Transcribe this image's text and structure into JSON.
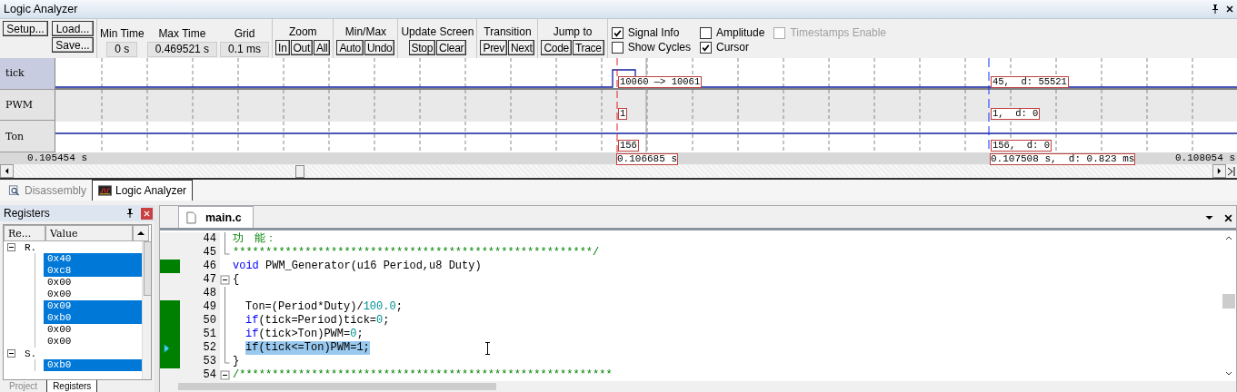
{
  "window": {
    "title": "Logic Analyzer"
  },
  "toolbar": {
    "left_buttons": [
      "Setup...",
      "Load...",
      "Save..."
    ],
    "fields": [
      {
        "label": "Min Time",
        "value": "0 s"
      },
      {
        "label": "Max Time",
        "value": "0.469521 s"
      },
      {
        "label": "Grid",
        "value": "0.1 ms"
      }
    ],
    "button_groups": [
      {
        "title": "Zoom",
        "buttons": [
          "In",
          "Out",
          "All"
        ]
      },
      {
        "title": "Min/Max",
        "buttons": [
          "Auto",
          "Undo"
        ]
      },
      {
        "title": "Update Screen",
        "buttons": [
          "Stop",
          "Clear"
        ]
      },
      {
        "title": "Transition",
        "buttons": [
          "Prev",
          "Next"
        ]
      },
      {
        "title": "Jump to",
        "buttons": [
          "Code",
          "Trace"
        ]
      }
    ],
    "options": [
      {
        "label": "Signal Info",
        "checked": true,
        "disabled": false
      },
      {
        "label": "Amplitude",
        "checked": false,
        "disabled": false
      },
      {
        "label": "Timestamps Enable",
        "checked": false,
        "disabled": true
      },
      {
        "label": "Show Cycles",
        "checked": false,
        "disabled": false
      },
      {
        "label": "Cursor",
        "checked": true,
        "disabled": false
      }
    ]
  },
  "waveform": {
    "signals": [
      {
        "name": "tick",
        "kind": "pulse",
        "cursor_label": "10060 —> 10061",
        "marker_label": "45,  d: 55521"
      },
      {
        "name": "PWM",
        "kind": "empty",
        "cursor_label": "1",
        "marker_label": "1,  d: 0"
      },
      {
        "name": "Ton",
        "kind": "flat",
        "cursor_label": "156",
        "marker_label": "156,  d: 0"
      }
    ],
    "time_axis": {
      "start": "0.105454 s",
      "cursor": "0.106685 s",
      "marker": "0.107508 s,  d: 0.823 ms",
      "end": "0.108054 s"
    }
  },
  "tabs": [
    {
      "label": "Disassembly",
      "selected": false
    },
    {
      "label": "Logic Analyzer",
      "selected": true
    }
  ],
  "registers": {
    "title": "Registers",
    "columns": [
      "Re...",
      "Value"
    ],
    "tree": [
      {
        "label": "R.",
        "expanded": true,
        "children": [
          {
            "value": "0x40",
            "selected": true
          },
          {
            "value": "0xc8",
            "selected": true
          },
          {
            "value": "0x00",
            "selected": false
          },
          {
            "value": "0x00",
            "selected": false
          },
          {
            "value": "0x09",
            "selected": true
          },
          {
            "value": "0xb0",
            "selected": true
          },
          {
            "value": "0x00",
            "selected": false
          },
          {
            "value": "0x00",
            "selected": false
          }
        ]
      },
      {
        "label": "S.",
        "expanded": true,
        "children": [
          {
            "value": "0xb0",
            "selected": true
          }
        ]
      }
    ],
    "tabs": [
      {
        "label": "Project",
        "selected": false
      },
      {
        "label": "Registers",
        "selected": true
      }
    ]
  },
  "editor": {
    "tab": "main.c",
    "lines": [
      {
        "number": "44",
        "executed": false,
        "current": false,
        "selected": false,
        "kind": "fold-body",
        "indented": false,
        "tokens": [
          {
            "text": "功　能：",
            "kind": "comment"
          }
        ]
      },
      {
        "number": "45",
        "executed": false,
        "current": false,
        "selected": false,
        "kind": "fold-end",
        "indented": false,
        "tokens": [
          {
            "text": "*******************************************************/",
            "kind": "comment"
          }
        ]
      },
      {
        "number": "46",
        "executed": true,
        "current": false,
        "selected": false,
        "kind": "plain",
        "indented": false,
        "tokens": [
          {
            "text": "void",
            "kind": "keyword"
          },
          {
            "text": " PWM_Generator(u16 Period,u8 Duty)",
            "kind": "plain"
          }
        ]
      },
      {
        "number": "47",
        "executed": false,
        "current": false,
        "selected": false,
        "kind": "fold-start",
        "indented": false,
        "tokens": [
          {
            "text": "{",
            "kind": "plain"
          }
        ]
      },
      {
        "number": "48",
        "executed": false,
        "current": false,
        "selected": false,
        "kind": "fold-body",
        "indented": false
      },
      {
        "number": "49",
        "executed": true,
        "current": false,
        "selected": false,
        "kind": "fold-body",
        "indented": true,
        "tokens": [
          {
            "text": "Ton=(Period*Duty)/",
            "kind": "plain"
          },
          {
            "text": "100.0",
            "kind": "number"
          },
          {
            "text": ";",
            "kind": "plain"
          }
        ]
      },
      {
        "number": "50",
        "executed": true,
        "current": false,
        "selected": false,
        "kind": "fold-body",
        "indented": true,
        "tokens": [
          {
            "text": "if",
            "kind": "keyword"
          },
          {
            "text": "(tick=Period)tick=",
            "kind": "plain"
          },
          {
            "text": "0",
            "kind": "number"
          },
          {
            "text": ";",
            "kind": "plain"
          }
        ]
      },
      {
        "number": "51",
        "executed": true,
        "current": false,
        "selected": false,
        "kind": "fold-body",
        "indented": true,
        "tokens": [
          {
            "text": "if",
            "kind": "keyword"
          },
          {
            "text": "(tick>Ton)PWM=",
            "kind": "plain"
          },
          {
            "text": "0",
            "kind": "number"
          },
          {
            "text": ";",
            "kind": "plain"
          }
        ]
      },
      {
        "number": "52",
        "executed": true,
        "current": true,
        "selected": true,
        "kind": "fold-body",
        "indented": true,
        "tokens": [
          {
            "text": "if(tick<=Ton)PWM=1;",
            "kind": "plain"
          }
        ]
      },
      {
        "number": "53",
        "executed": true,
        "current": false,
        "selected": false,
        "kind": "fold-end",
        "indented": false,
        "tokens": [
          {
            "text": "}",
            "kind": "plain"
          }
        ]
      },
      {
        "number": "54",
        "executed": false,
        "current": false,
        "selected": false,
        "kind": "fold-start",
        "indented": false,
        "tokens": [
          {
            "text": "/*********************************************************",
            "kind": "comment"
          }
        ]
      }
    ]
  }
}
